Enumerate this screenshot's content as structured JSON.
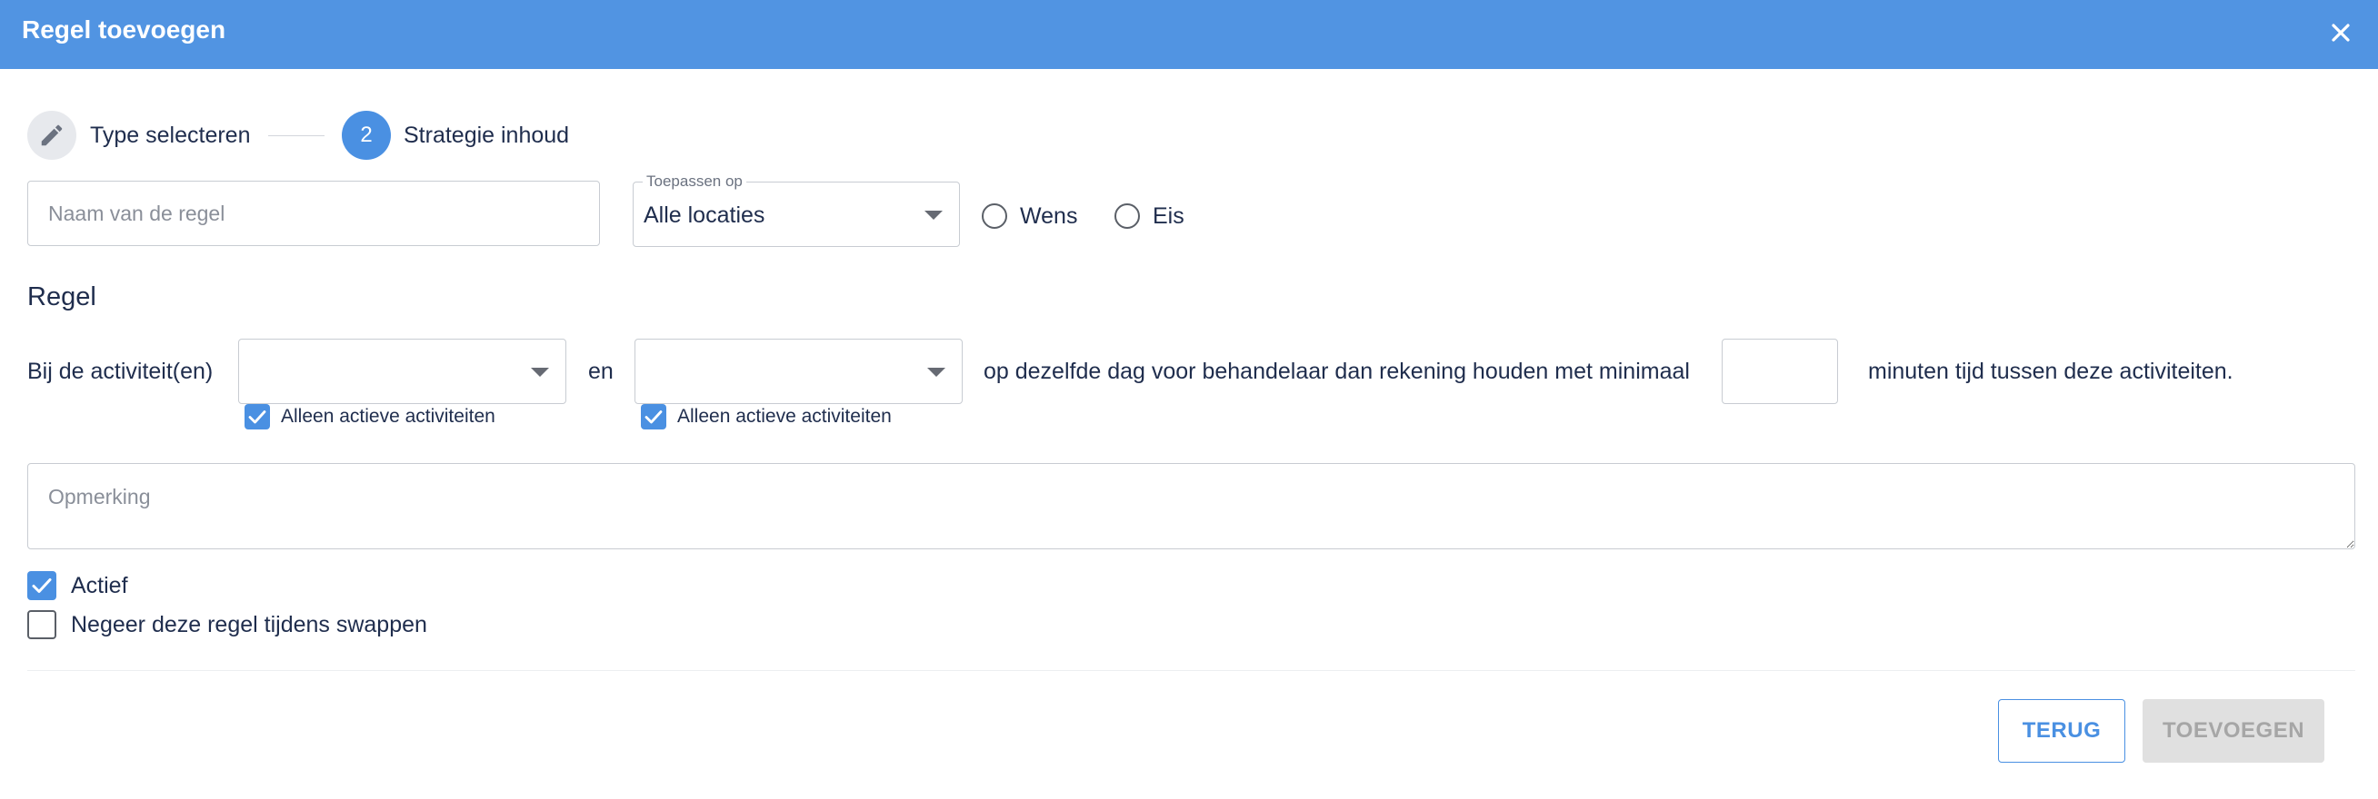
{
  "dialog": {
    "title": "Regel toevoegen",
    "accent_color": "#5194e2"
  },
  "stepper": {
    "steps": [
      {
        "label": "Type selecteren",
        "icon": "pencil-icon",
        "state": "completed"
      },
      {
        "number": "2",
        "label": "Strategie inhoud",
        "state": "active"
      }
    ]
  },
  "form": {
    "name_placeholder": "Naam van de regel",
    "apply_to": {
      "legend": "Toepassen op",
      "value": "Alle locaties"
    },
    "priority": {
      "options": [
        "Wens",
        "Eis"
      ],
      "selected": null
    }
  },
  "rule": {
    "section_title": "Regel",
    "text_start": "Bij de activiteit(en)",
    "text_and": "en",
    "text_middle": "op dezelfde dag voor behandelaar dan rekening houden met minimaal",
    "text_end": "minuten tijd tussen deze activiteiten.",
    "activity_1": {
      "value": "",
      "only_active_label": "Alleen actieve activiteiten",
      "only_active_checked": true
    },
    "activity_2": {
      "value": "",
      "only_active_label": "Alleen actieve activiteiten",
      "only_active_checked": true
    },
    "minutes_value": ""
  },
  "remark": {
    "placeholder": "Opmerking"
  },
  "options": {
    "active": {
      "label": "Actief",
      "checked": true
    },
    "ignore_swap": {
      "label": "Negeer deze regel tijdens swappen",
      "checked": false
    }
  },
  "footer": {
    "back_label": "TERUG",
    "add_label": "TOEVOEGEN",
    "add_disabled": true
  }
}
